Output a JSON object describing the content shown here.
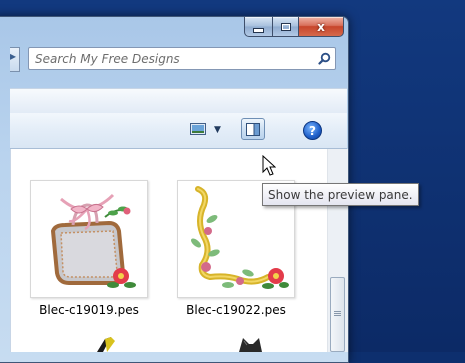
{
  "window": {
    "caption_buttons": {
      "minimize_icon": "minimize-icon",
      "maximize_icon": "maximize-icon",
      "close_glyph": "x"
    }
  },
  "search": {
    "placeholder": "Search My Free Designs",
    "icon": "search-icon"
  },
  "toolbar": {
    "views_icon": "change-view-icon",
    "preview_icon": "preview-pane-icon",
    "help_glyph": "?"
  },
  "tooltip": {
    "text": "Show the preview pane."
  },
  "files": [
    {
      "name": "Blec-c19019.pes",
      "thumbnail": "embroidered-bag-with-pink-bow-icon"
    },
    {
      "name": "Blec-c19022.pes",
      "thumbnail": "floral-corner-border-icon"
    }
  ],
  "colors": {
    "desktop": "#0d2f6e",
    "close_button": "#c7452b",
    "help_button": "#1f5fc9"
  }
}
